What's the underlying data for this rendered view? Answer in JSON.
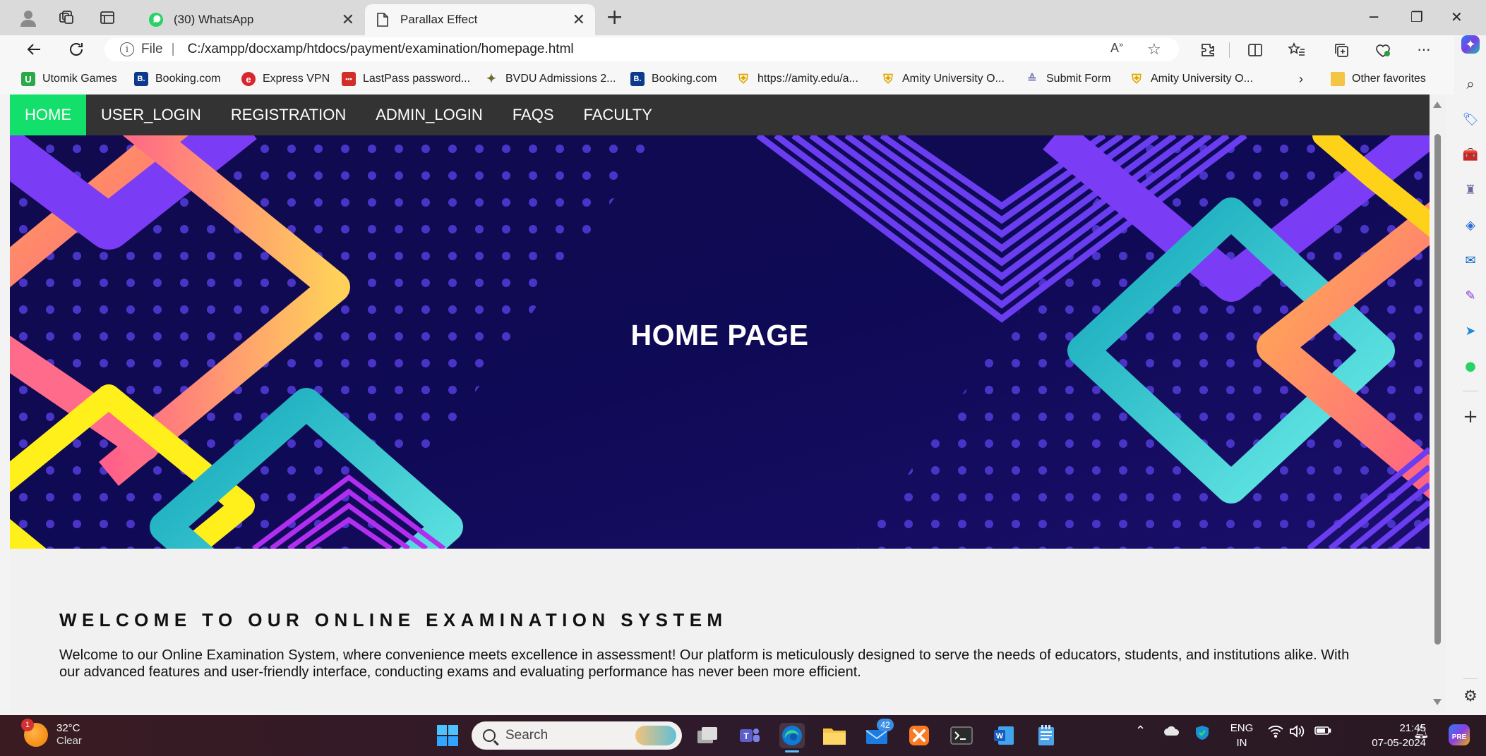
{
  "browser": {
    "tabs": [
      {
        "title": "(30) WhatsApp",
        "active": false
      },
      {
        "title": "Parallax Effect",
        "active": true
      }
    ],
    "address": {
      "scheme_label": "File",
      "url": "C:/xampp/docxamp/htdocs/payment/examination/homepage.html"
    },
    "favorites": [
      {
        "label": "Utomik Games",
        "color": "#2aa84a",
        "glyph": "U"
      },
      {
        "label": "Booking.com",
        "color": "#0c3b8c",
        "glyph": "B."
      },
      {
        "label": "Express VPN",
        "color": "#d9262e",
        "glyph": "e"
      },
      {
        "label": "LastPass password...",
        "color": "#d32d27",
        "glyph": "•••"
      },
      {
        "label": "BVDU Admissions 2...",
        "color": "#6b6b2a",
        "glyph": "✦"
      },
      {
        "label": "Booking.com",
        "color": "#0c3b8c",
        "glyph": "B."
      },
      {
        "label": "https://amity.edu/a...",
        "color": "#f0b400",
        "glyph": "⛨"
      },
      {
        "label": "Amity University O...",
        "color": "#f0b400",
        "glyph": "⛨"
      },
      {
        "label": "Submit Form",
        "color": "#7a7ab8",
        "glyph": "≙"
      },
      {
        "label": "Amity University O...",
        "color": "#f0b400",
        "glyph": "⛨"
      }
    ],
    "other_favorites": "Other favorites"
  },
  "page": {
    "nav": [
      {
        "label": "HOME",
        "active": true
      },
      {
        "label": "USER_LOGIN",
        "active": false
      },
      {
        "label": "REGISTRATION",
        "active": false
      },
      {
        "label": "ADMIN_LOGIN",
        "active": false
      },
      {
        "label": "FAQS",
        "active": false
      },
      {
        "label": "FACULTY",
        "active": false
      }
    ],
    "hero_title": "HOME PAGE",
    "welcome_heading": "WELCOME TO OUR ONLINE EXAMINATION SYSTEM",
    "welcome_text": "Welcome to our Online Examination System, where convenience meets excellence in assessment! Our platform is meticulously designed to serve the needs of educators, students, and institutions alike. With our advanced features and user-friendly interface, conducting exams and evaluating performance has never been more efficient.",
    "colors": {
      "nav_bg": "#333333",
      "nav_active": "#12e06a",
      "hero_bg": "#140c5a"
    }
  },
  "taskbar": {
    "weather_temp": "32°C",
    "weather_cond": "Clear",
    "weather_badge": "1",
    "search_placeholder": "Search",
    "mail_badge": "42",
    "lang_line1": "ENG",
    "lang_line2": "IN",
    "time": "21:45",
    "date": "07-05-2024"
  }
}
